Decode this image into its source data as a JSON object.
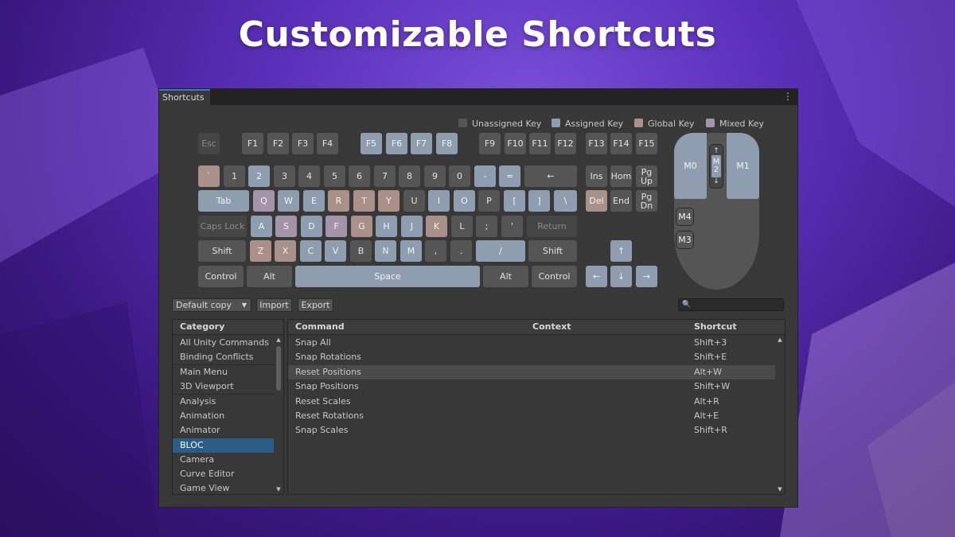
{
  "hero": {
    "title": "Customizable Shortcuts"
  },
  "window": {
    "tab": "Shortcuts",
    "menu_glyph": "⋮"
  },
  "colors": {
    "unassigned": "#555555",
    "assigned": "#8e9eb0",
    "global": "#a99089",
    "mixed": "#a394a9",
    "selection": "#2c5d87"
  },
  "legend": {
    "unassigned": "Unassigned Key",
    "assigned": "Assigned Key",
    "global": "Global Key",
    "mixed": "Mixed Key"
  },
  "keyboard": {
    "fn_row": [
      "Esc",
      "F1",
      "F2",
      "F3",
      "F4",
      "F5",
      "F6",
      "F7",
      "F8",
      "F9",
      "F10",
      "F11",
      "F12",
      "F13",
      "F14",
      "F15"
    ],
    "num_row": [
      "`",
      "1",
      "2",
      "3",
      "4",
      "5",
      "6",
      "7",
      "8",
      "9",
      "0",
      "-",
      "=",
      "←",
      "Ins",
      "Hom",
      "Pg\nUp"
    ],
    "q_row": [
      "Tab",
      "Q",
      "W",
      "E",
      "R",
      "T",
      "Y",
      "U",
      "I",
      "O",
      "P",
      "[",
      "]",
      "\\",
      "Del",
      "End",
      "Pg\nDn"
    ],
    "a_row": [
      "Caps Lock",
      "A",
      "S",
      "D",
      "F",
      "G",
      "H",
      "J",
      "K",
      "L",
      ";",
      "'",
      "Return"
    ],
    "z_row": [
      "Shift",
      "Z",
      "X",
      "C",
      "V",
      "B",
      "N",
      "M",
      ",",
      ".",
      "/",
      "Shift",
      "↑"
    ],
    "bottom_row": [
      "Control",
      "Alt",
      "Space",
      "Alt",
      "Control",
      "←",
      "↓",
      "→"
    ]
  },
  "mouse": {
    "left": "M0",
    "right": "M1",
    "wheel": "M\n2",
    "wheel_up": "↑",
    "wheel_down": "↓",
    "side_top": "M4",
    "side_bottom": "M3"
  },
  "toolbar": {
    "profile": "Default copy",
    "dropdown_arrow": "▼",
    "import": "Import",
    "export": "Export",
    "search_icon": "🔍",
    "search_placeholder": ""
  },
  "categories": {
    "header": "Category",
    "items": [
      "All Unity Commands",
      "Binding Conflicts",
      "Main Menu",
      "3D Viewport",
      "Analysis",
      "Animation",
      "Animator",
      "BLOC",
      "Camera",
      "Curve Editor",
      "Game View"
    ],
    "selected": "BLOC"
  },
  "commands": {
    "headers": {
      "command": "Command",
      "context": "Context",
      "shortcut": "Shortcut"
    },
    "rows": [
      {
        "command": "Snap All",
        "shortcut": "Shift+3"
      },
      {
        "command": "Snap Rotations",
        "shortcut": "Shift+E"
      },
      {
        "command": "Reset Positions",
        "shortcut": "Alt+W"
      },
      {
        "command": "Snap Positions",
        "shortcut": "Shift+W"
      },
      {
        "command": "Reset Scales",
        "shortcut": "Alt+R"
      },
      {
        "command": "Reset Rotations",
        "shortcut": "Alt+E"
      },
      {
        "command": "Snap Scales",
        "shortcut": "Shift+R"
      }
    ],
    "highlighted": "Reset Positions"
  },
  "scroll": {
    "up": "▲",
    "down": "▼"
  }
}
